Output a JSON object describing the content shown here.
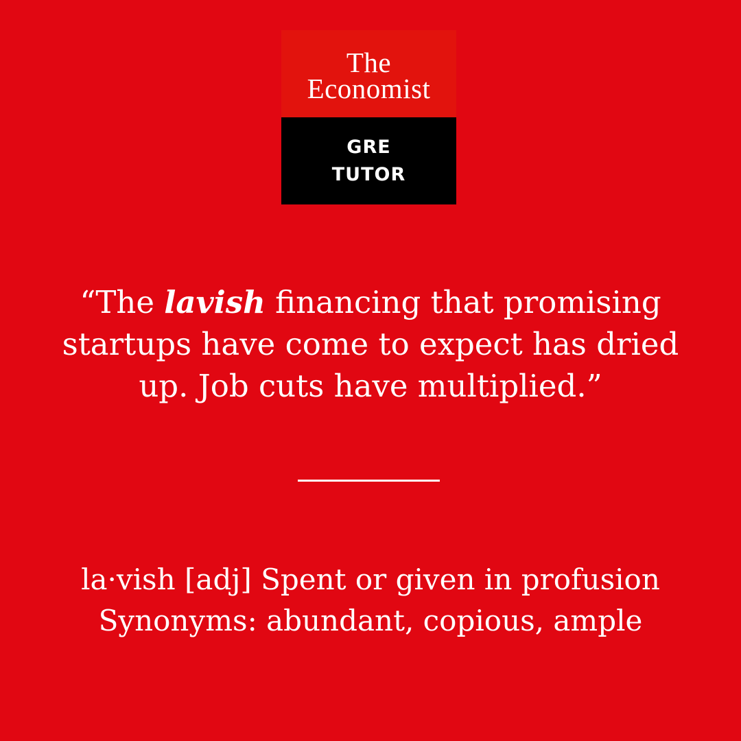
{
  "logo": {
    "line1": "The",
    "line2": "Economist",
    "sub1": "GRE",
    "sub2": "TUTOR"
  },
  "quote": {
    "before": "“The ",
    "highlight": "lavish",
    "after": " financing that promising startups have come to expect has dried up. Job cuts have multiplied.”"
  },
  "definition": {
    "entry": "la·vish [adj] Spent or given in profusion",
    "synonyms": "Synonyms: abundant, copious, ample"
  },
  "colors": {
    "background": "#e10712",
    "logo_red": "#e2130d",
    "logo_black": "#000000",
    "text": "#ffffff"
  }
}
